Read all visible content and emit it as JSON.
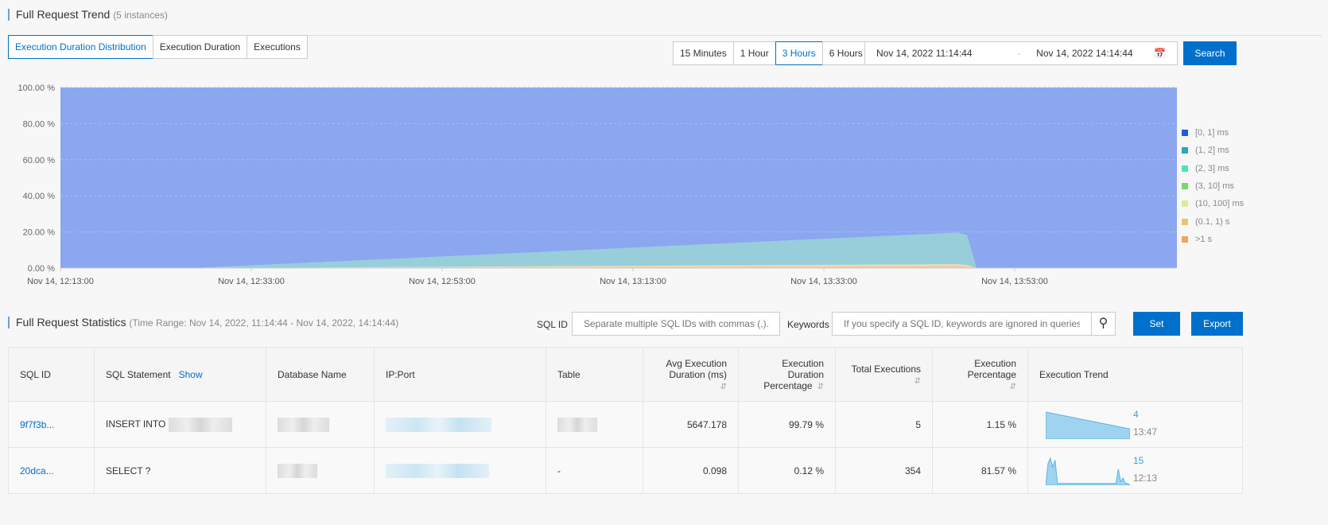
{
  "trend": {
    "title": "Full Request Trend",
    "subtitle": "(5 instances)",
    "tabs": [
      "Execution Duration Distribution",
      "Execution Duration",
      "Executions"
    ],
    "ranges": [
      "15 Minutes",
      "1 Hour",
      "3 Hours",
      "6 Hours"
    ],
    "start": "Nov 14, 2022 11:14:44",
    "sep": "-",
    "end": "Nov 14, 2022 14:14:44",
    "search": "Search"
  },
  "chart_data": {
    "type": "area",
    "stacked": true,
    "ylim": [
      0,
      100
    ],
    "yticks": [
      "0.00 %",
      "20.00 %",
      "40.00 %",
      "60.00 %",
      "80.00 %",
      "100.00 %"
    ],
    "xticks": [
      "Nov 14, 12:13:00",
      "Nov 14, 12:33:00",
      "Nov 14, 12:53:00",
      "Nov 14, 13:13:00",
      "Nov 14, 13:33:00",
      "Nov 14, 13:53:00"
    ],
    "x_minutes_from_1213": [
      0,
      14,
      94,
      95,
      96,
      117
    ],
    "legend_position": "right",
    "series": [
      {
        "name": "[0, 1] ms",
        "color": "#1f5ae6",
        "fill": "#8aa7ef",
        "values": [
          100,
          100,
          80.4,
          81.8,
          100,
          100
        ]
      },
      {
        "name": "(1, 2] ms",
        "color": "#2ba6bd",
        "fill": "#97ced9",
        "values": [
          0,
          0,
          17.5,
          16.5,
          0,
          0
        ]
      },
      {
        "name": "(2, 3] ms",
        "color": "#4de3bd",
        "fill": "#a6eddb",
        "values": [
          0,
          0,
          0,
          0,
          0,
          0
        ]
      },
      {
        "name": "(3, 10] ms",
        "color": "#7ad66f",
        "fill": "#b7e6b1",
        "values": [
          0,
          0,
          0,
          0,
          0,
          0
        ]
      },
      {
        "name": "(10, 100] ms",
        "color": "#dfeb94",
        "fill": "#efe4ab",
        "values": [
          0,
          0,
          0.6,
          0.5,
          0,
          0
        ]
      },
      {
        "name": "(0.1, 1) s",
        "color": "#e8c56e",
        "fill": "#f0d9a6",
        "values": [
          0,
          0,
          0,
          0,
          0,
          0
        ]
      },
      {
        "name": ">1 s",
        "color": "#f2a45a",
        "fill": "#f5caa5",
        "values": [
          0,
          0,
          1.5,
          1.2,
          0,
          0
        ]
      }
    ]
  },
  "stats": {
    "title": "Full Request Statistics",
    "subtitle": "(Time Range: Nov 14, 2022, 11:14:44 - Nov 14, 2022, 14:14:44)",
    "sqlid_label": "SQL ID",
    "sqlid_placeholder": "Separate multiple SQL IDs with commas (,).",
    "keywords_label": "Keywords",
    "keywords_placeholder": "If you specify a SQL ID, keywords are ignored in queries.",
    "set": "Set",
    "export": "Export",
    "columns": {
      "sqlid": "SQL ID",
      "stmt": "SQL Statement",
      "show": "Show",
      "db": "Database Name",
      "ip": "IP:Port",
      "table": "Table",
      "avg": "Avg Execution Duration (ms)",
      "pct": "Execution Duration Percentage",
      "total": "Total Executions",
      "epct": "Execution Percentage",
      "trend": "Execution Trend"
    },
    "rows": [
      {
        "id": "9f7f3b...",
        "stmt": "INSERT INTO",
        "table": "",
        "avg": "5647.178",
        "pct": "99.79 %",
        "total": "5",
        "epct": "1.15 %",
        "peak": "4",
        "time": "13:47",
        "spark": [
          4,
          3.5,
          3,
          2.5,
          2,
          1.5
        ]
      },
      {
        "id": "20dca...",
        "stmt": "SELECT ?",
        "table": "-",
        "avg": "0.098",
        "pct": "0.12 %",
        "total": "354",
        "epct": "81.57 %",
        "peak": "15",
        "time": "12:13",
        "spark": [
          0,
          12,
          15,
          10,
          14,
          1,
          1,
          1,
          1,
          1,
          1,
          1,
          1,
          1,
          1,
          1,
          1,
          1,
          1,
          1,
          1,
          1,
          1,
          1,
          1,
          1,
          1,
          1,
          1,
          1,
          1,
          9,
          2,
          4,
          1,
          1,
          0
        ]
      }
    ]
  }
}
